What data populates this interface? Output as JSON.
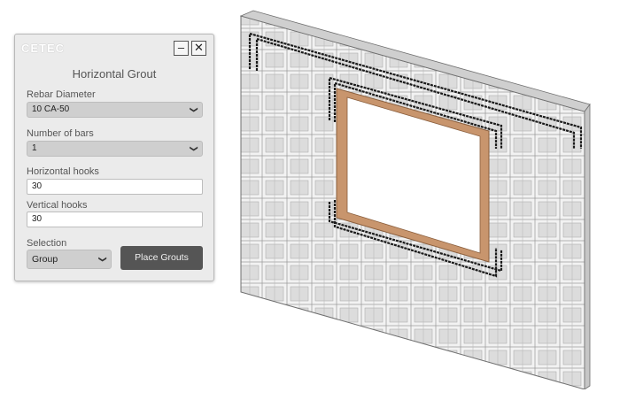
{
  "window": {
    "logo": "CETEC",
    "title": "Horizontal Grout",
    "minimize_label": "–",
    "close_label": "✕"
  },
  "form": {
    "rebar_diameter": {
      "label": "Rebar Diameter",
      "value": "10 CA-50"
    },
    "number_of_bars": {
      "label": "Number of bars",
      "value": "1"
    },
    "horizontal_hooks": {
      "label": "Horizontal hooks",
      "value": "30"
    },
    "vertical_hooks": {
      "label": "Vertical hooks",
      "value": "30"
    },
    "selection": {
      "label": "Selection",
      "value": "Group"
    },
    "place_button": "Place Grouts"
  },
  "icons": {
    "dropdown": "chevron-down-icon"
  },
  "colors": {
    "panel_bg": "#ebebeb",
    "button_dark": "#555555",
    "frame": "#c8956d",
    "rebar": "#1a1a1a",
    "block": "#d9d9d9"
  }
}
